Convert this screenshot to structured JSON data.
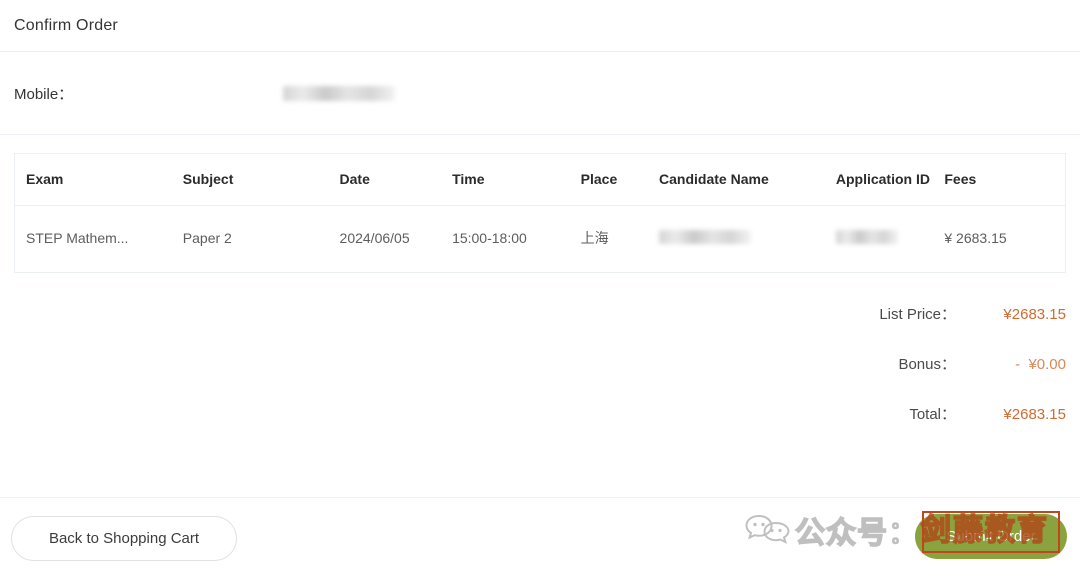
{
  "header": {
    "title": "Confirm Order"
  },
  "contact": {
    "mobile_label": "Mobile：",
    "mobile_value_redacted": true
  },
  "table": {
    "columns": [
      "Exam",
      "Subject",
      "Date",
      "Time",
      "Place",
      "Candidate Name",
      "Application ID",
      "Fees"
    ],
    "rows": [
      {
        "exam": "STEP Mathem...",
        "subject": "Paper 2",
        "date": "2024/06/05",
        "time": "15:00-18:00",
        "place": "上海",
        "candidate_name": "",
        "application_id": "",
        "fees": "¥ 2683.15"
      }
    ]
  },
  "summary": {
    "rows": [
      {
        "label": "List Price：",
        "value": "¥2683.15"
      },
      {
        "label": "Bonus：",
        "value": "-  ¥0.00"
      },
      {
        "label": "Total：",
        "value": "¥2683.15"
      }
    ]
  },
  "footer": {
    "back_label": "Back to Shopping Cart",
    "submit_label": "Submit Order"
  },
  "watermark": {
    "prefix": "公众号：",
    "brand": "剑藤教育"
  },
  "colors": {
    "accent_orange": "#cf6b33",
    "submit_green": "#8aa33f",
    "annotation_red": "#c0471c",
    "divider": "#ebeef5"
  }
}
